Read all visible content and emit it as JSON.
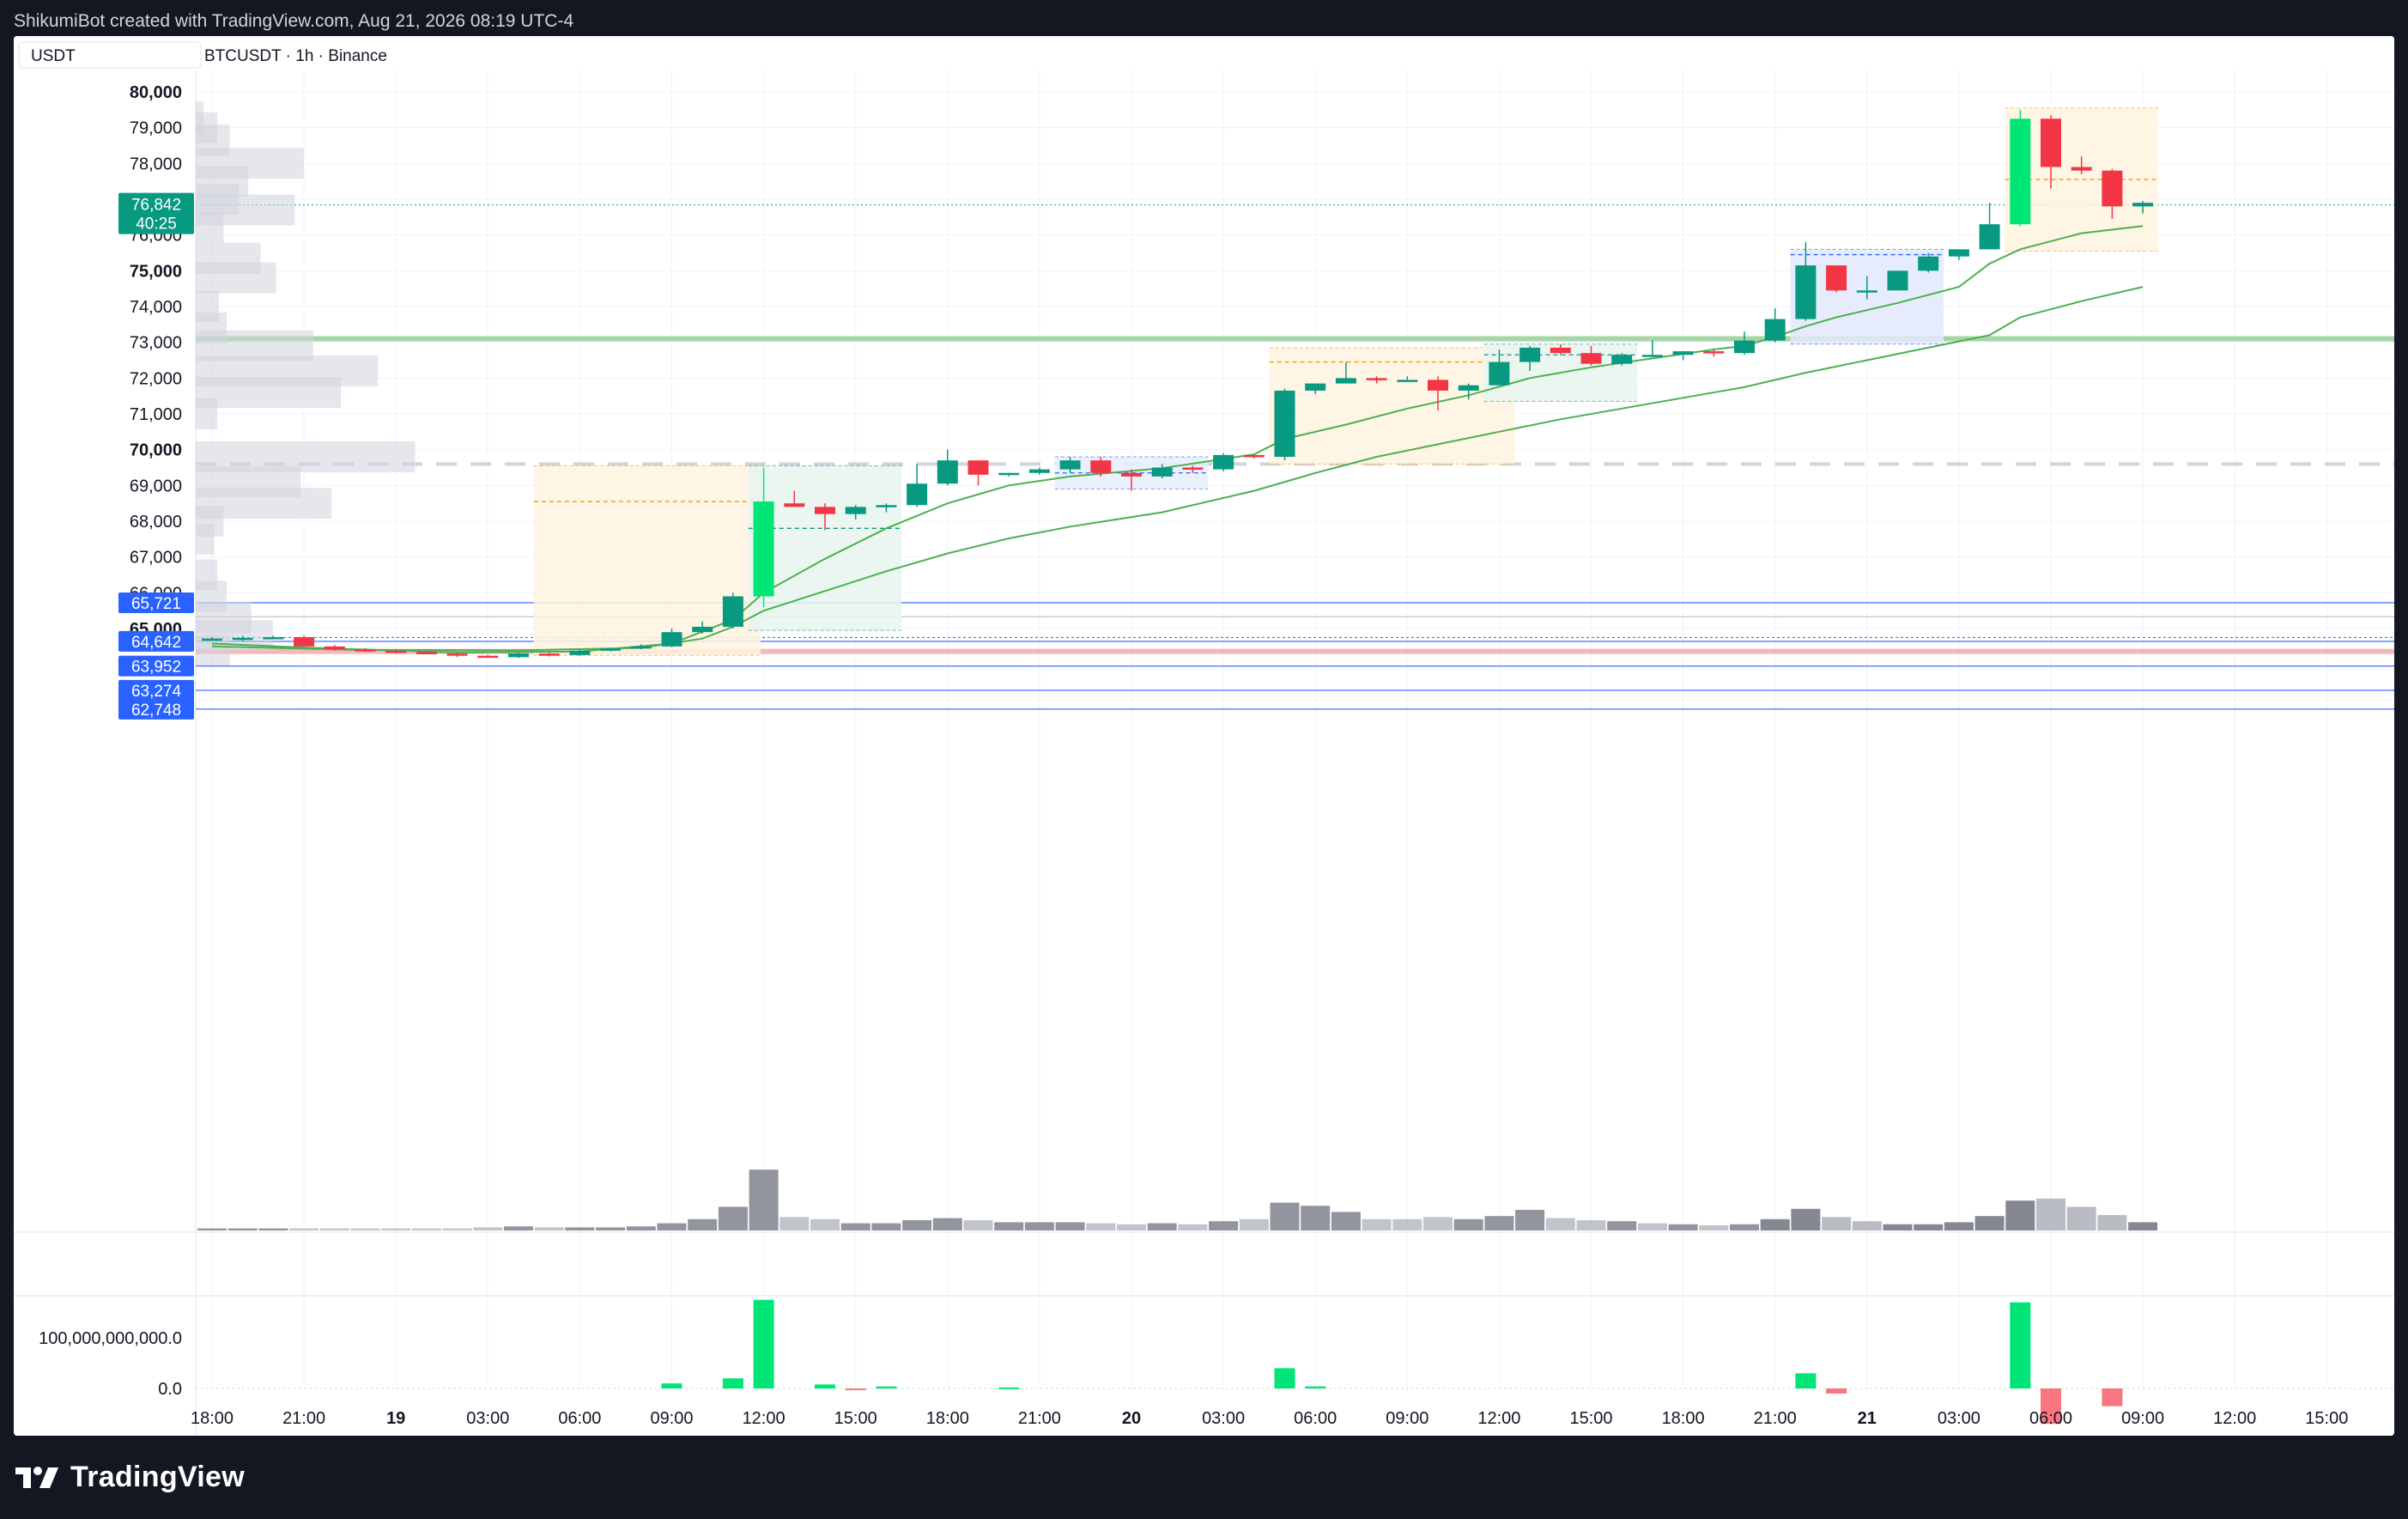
{
  "watermark": "ShikumiBot created with TradingView.com, Aug 21, 2026 08:19 UTC-4",
  "header": {
    "currency": "USDT",
    "symbol_line": "BTCUSDT · 1h · Binance"
  },
  "brand": {
    "name": "TradingView"
  },
  "colors": {
    "up": "#089981",
    "down": "#f23645",
    "up_bright": "#00e676",
    "ma": "#4caf50",
    "level_line": "#2962ff",
    "support_band": "#a5d6a7",
    "resistance_band": "#ef9a9a"
  },
  "chart_data": {
    "type": "candlestick",
    "symbol": "BTCUSDT",
    "interval": "1h",
    "exchange": "Binance",
    "ylim": [
      62600,
      80600
    ],
    "y_ticks": [
      {
        "value": 80000,
        "label": "80,000",
        "bold": true
      },
      {
        "value": 79000,
        "label": "79,000",
        "bold": false
      },
      {
        "value": 78000,
        "label": "78,000",
        "bold": false
      },
      {
        "value": 77000,
        "label": "77,000",
        "bold": false
      },
      {
        "value": 76000,
        "label": "76,000",
        "bold": false
      },
      {
        "value": 75000,
        "label": "75,000",
        "bold": true
      },
      {
        "value": 74000,
        "label": "74,000",
        "bold": false
      },
      {
        "value": 73000,
        "label": "73,000",
        "bold": false
      },
      {
        "value": 72000,
        "label": "72,000",
        "bold": false
      },
      {
        "value": 71000,
        "label": "71,000",
        "bold": false
      },
      {
        "value": 70000,
        "label": "70,000",
        "bold": true
      },
      {
        "value": 69000,
        "label": "69,000",
        "bold": false
      },
      {
        "value": 68000,
        "label": "68,000",
        "bold": false
      },
      {
        "value": 67000,
        "label": "67,000",
        "bold": false
      },
      {
        "value": 66000,
        "label": "66,000",
        "bold": false
      },
      {
        "value": 65000,
        "label": "65,000",
        "bold": true
      },
      {
        "value": 63000,
        "label": "63,000",
        "bold": false
      }
    ],
    "x_ticks": [
      {
        "label": "18:00",
        "bold": false
      },
      {
        "label": "21:00",
        "bold": false
      },
      {
        "label": "19",
        "bold": true
      },
      {
        "label": "03:00",
        "bold": false
      },
      {
        "label": "06:00",
        "bold": false
      },
      {
        "label": "09:00",
        "bold": false
      },
      {
        "label": "12:00",
        "bold": false
      },
      {
        "label": "15:00",
        "bold": false
      },
      {
        "label": "18:00",
        "bold": false
      },
      {
        "label": "21:00",
        "bold": false
      },
      {
        "label": "20",
        "bold": true
      },
      {
        "label": "03:00",
        "bold": false
      },
      {
        "label": "06:00",
        "bold": false
      },
      {
        "label": "09:00",
        "bold": false
      },
      {
        "label": "12:00",
        "bold": false
      },
      {
        "label": "15:00",
        "bold": false
      },
      {
        "label": "18:00",
        "bold": false
      },
      {
        "label": "21:00",
        "bold": false
      },
      {
        "label": "21",
        "bold": true
      },
      {
        "label": "03:00",
        "bold": false
      },
      {
        "label": "06:00",
        "bold": false
      },
      {
        "label": "09:00",
        "bold": false
      },
      {
        "label": "12:00",
        "bold": false
      },
      {
        "label": "15:00",
        "bold": false
      }
    ],
    "x_tick_step_bars": 3,
    "total_slots": 72,
    "candles": [
      [
        64700,
        64760,
        64660,
        64720
      ],
      [
        64720,
        64800,
        64650,
        64740
      ],
      [
        64740,
        64800,
        64700,
        64760
      ],
      [
        64760,
        64800,
        64480,
        64500
      ],
      [
        64500,
        64540,
        64380,
        64420
      ],
      [
        64420,
        64460,
        64340,
        64380
      ],
      [
        64380,
        64420,
        64300,
        64340
      ],
      [
        64340,
        64380,
        64280,
        64300
      ],
      [
        64300,
        64340,
        64200,
        64240
      ],
      [
        64240,
        64260,
        64180,
        64200
      ],
      [
        64200,
        64320,
        64180,
        64300
      ],
      [
        64300,
        64340,
        64220,
        64260
      ],
      [
        64260,
        64400,
        64240,
        64380
      ],
      [
        64380,
        64460,
        64360,
        64440
      ],
      [
        64440,
        64560,
        64420,
        64500
      ],
      [
        64500,
        65000,
        64480,
        64900
      ],
      [
        64900,
        65200,
        64860,
        65050
      ],
      [
        65050,
        66000,
        65000,
        65900
      ],
      [
        65900,
        69500,
        65600,
        68550
      ],
      [
        68500,
        68850,
        68400,
        68400
      ],
      [
        68400,
        68500,
        67750,
        68200
      ],
      [
        68200,
        68450,
        68050,
        68400
      ],
      [
        68400,
        68500,
        68250,
        68450
      ],
      [
        68450,
        69600,
        68400,
        69050
      ],
      [
        69050,
        70000,
        69000,
        69700
      ],
      [
        69700,
        69700,
        69000,
        69300
      ],
      [
        69300,
        69350,
        69250,
        69350
      ],
      [
        69350,
        69500,
        69300,
        69450
      ],
      [
        69450,
        69800,
        69350,
        69700
      ],
      [
        69700,
        69800,
        69250,
        69350
      ],
      [
        69350,
        69450,
        68850,
        69250
      ],
      [
        69250,
        69600,
        69200,
        69500
      ],
      [
        69500,
        69550,
        69350,
        69450
      ],
      [
        69450,
        69900,
        69400,
        69850
      ],
      [
        69850,
        69850,
        69750,
        69800
      ],
      [
        69800,
        71700,
        69700,
        71650
      ],
      [
        71650,
        71850,
        71550,
        71850
      ],
      [
        71850,
        72450,
        71850,
        72000
      ],
      [
        72000,
        72050,
        71850,
        71950
      ],
      [
        71950,
        72050,
        71950,
        71950
      ],
      [
        71950,
        72050,
        71100,
        71650
      ],
      [
        71650,
        71850,
        71400,
        71800
      ],
      [
        71800,
        72800,
        71800,
        72450
      ],
      [
        72450,
        72900,
        72200,
        72850
      ],
      [
        72850,
        72950,
        72650,
        72700
      ],
      [
        72700,
        72900,
        72350,
        72400
      ],
      [
        72400,
        72700,
        72350,
        72650
      ],
      [
        72650,
        73050,
        72600,
        72650
      ],
      [
        72650,
        72750,
        72500,
        72750
      ],
      [
        72750,
        72800,
        72600,
        72700
      ],
      [
        72700,
        73300,
        72650,
        73050
      ],
      [
        73050,
        73950,
        73000,
        73650
      ],
      [
        73650,
        75800,
        73600,
        75150
      ],
      [
        75150,
        75150,
        74400,
        74450
      ],
      [
        74450,
        74850,
        74200,
        74450
      ],
      [
        74450,
        75000,
        74450,
        75000
      ],
      [
        75000,
        75500,
        74950,
        75400
      ],
      [
        75400,
        75600,
        75300,
        75600
      ],
      [
        75600,
        76900,
        75600,
        76300
      ],
      [
        76300,
        79500,
        76250,
        79250
      ],
      [
        79250,
        79350,
        77300,
        77900
      ],
      [
        77900,
        78200,
        77700,
        77800
      ],
      [
        77800,
        77850,
        76450,
        76800
      ],
      [
        76800,
        76950,
        76600,
        76900
      ]
    ],
    "ema_fast": [
      [
        0,
        64580
      ],
      [
        3,
        64470
      ],
      [
        8,
        64330
      ],
      [
        12,
        64360
      ],
      [
        15,
        64580
      ],
      [
        17,
        65250
      ],
      [
        18,
        66000
      ],
      [
        20,
        66950
      ],
      [
        22,
        67800
      ],
      [
        24,
        68500
      ],
      [
        26,
        69000
      ],
      [
        28,
        69250
      ],
      [
        31,
        69480
      ],
      [
        34,
        69870
      ],
      [
        35,
        70300
      ],
      [
        37,
        70700
      ],
      [
        39,
        71150
      ],
      [
        41,
        71520
      ],
      [
        43,
        72000
      ],
      [
        45,
        72300
      ],
      [
        47,
        72550
      ],
      [
        49,
        72800
      ],
      [
        50,
        72900
      ],
      [
        51,
        73150
      ],
      [
        52,
        73450
      ],
      [
        53,
        73700
      ],
      [
        55,
        74100
      ],
      [
        57,
        74550
      ],
      [
        58,
        75200
      ],
      [
        59,
        75600
      ],
      [
        61,
        76050
      ],
      [
        63,
        76250
      ]
    ],
    "ema_slow": [
      [
        0,
        64500
      ],
      [
        5,
        64400
      ],
      [
        10,
        64390
      ],
      [
        14,
        64460
      ],
      [
        16,
        64720
      ],
      [
        17,
        65050
      ],
      [
        18,
        65500
      ],
      [
        20,
        66050
      ],
      [
        22,
        66600
      ],
      [
        24,
        67100
      ],
      [
        26,
        67520
      ],
      [
        28,
        67850
      ],
      [
        31,
        68250
      ],
      [
        34,
        68850
      ],
      [
        36,
        69350
      ],
      [
        38,
        69800
      ],
      [
        40,
        70150
      ],
      [
        42,
        70500
      ],
      [
        44,
        70850
      ],
      [
        46,
        71150
      ],
      [
        48,
        71450
      ],
      [
        50,
        71750
      ],
      [
        52,
        72150
      ],
      [
        54,
        72500
      ],
      [
        56,
        72850
      ],
      [
        58,
        73200
      ],
      [
        59,
        73700
      ],
      [
        61,
        74150
      ],
      [
        63,
        74550
      ]
    ],
    "current_price": {
      "value": 76842,
      "label": "76,842",
      "countdown": "40:25"
    },
    "price_tags": [
      {
        "value": 65721,
        "label": "65,721"
      },
      {
        "value": 64642,
        "label": "64,642"
      },
      {
        "value": 63952,
        "label": "63,952"
      },
      {
        "value": 63274,
        "label": "63,274"
      },
      {
        "value": 62748,
        "label": "62,748"
      }
    ],
    "gray_dashed_level": 69600,
    "green_level": 73100,
    "red_level": 64360,
    "range_boxes": [
      {
        "x0": 10.5,
        "x1": 17.9,
        "top": 69550,
        "bottom": 64250,
        "fill": "#fff3e0",
        "mid": 68550,
        "mid_to": 18.2,
        "mid_color": "#ff9800"
      },
      {
        "x0": 17.5,
        "x1": 22.5,
        "top": 69550,
        "bottom": 64950,
        "fill": "#e8f5ee",
        "mid": 67800,
        "mid_color": "#089981"
      },
      {
        "x0": 27.5,
        "x1": 32.5,
        "top": 69800,
        "bottom": 68900,
        "fill": "#e8eefb",
        "mid": 69350,
        "mid_color": "#2962ff"
      },
      {
        "x0": 34.5,
        "x1": 42.5,
        "top": 72850,
        "bottom": 69600,
        "fill": "#fff3e0",
        "mid": 72450,
        "mid_color": "#ff9800"
      },
      {
        "x0": 41.5,
        "x1": 46.5,
        "top": 72950,
        "bottom": 71350,
        "fill": "#e8f5ee",
        "mid": 72650,
        "mid_color": "#089981"
      },
      {
        "x0": 51.5,
        "x1": 56.5,
        "top": 75600,
        "bottom": 72950,
        "fill": "#e3e9fd",
        "mid": 75450,
        "mid_color": "#2962ff"
      },
      {
        "x0": 58.5,
        "x1": 63.5,
        "top": 79550,
        "bottom": 75550,
        "fill": "#fff3e0",
        "mid": 77550,
        "mid_color": "#ff9800"
      }
    ],
    "volume_profile": [
      [
        79300,
        5
      ],
      [
        79000,
        14
      ],
      [
        78650,
        22
      ],
      [
        78000,
        70
      ],
      [
        77500,
        34
      ],
      [
        77000,
        28
      ],
      [
        76700,
        64
      ],
      [
        76200,
        18
      ],
      [
        75350,
        42
      ],
      [
        74800,
        52
      ],
      [
        74000,
        15
      ],
      [
        73400,
        20
      ],
      [
        72900,
        76
      ],
      [
        72200,
        118
      ],
      [
        71600,
        94
      ],
      [
        71000,
        14
      ],
      [
        69800,
        142
      ],
      [
        69100,
        68
      ],
      [
        68500,
        88
      ],
      [
        68000,
        18
      ],
      [
        67500,
        12
      ],
      [
        66500,
        14
      ],
      [
        65900,
        20
      ],
      [
        65300,
        36
      ],
      [
        64800,
        50
      ],
      [
        64400,
        22
      ]
    ],
    "volume": [
      2,
      2,
      2,
      2,
      2,
      2,
      2,
      2,
      2,
      3,
      4,
      3,
      3,
      3,
      4,
      7,
      11,
      23,
      59,
      13,
      11,
      7,
      7,
      10,
      12,
      10,
      8,
      8,
      8,
      7,
      6,
      7,
      6,
      9,
      11,
      27,
      24,
      18,
      11,
      11,
      13,
      11,
      14,
      20,
      12,
      10,
      9,
      7,
      6,
      5,
      6,
      11,
      21,
      13,
      9,
      6,
      6,
      8,
      14,
      29,
      31,
      23,
      15,
      8
    ],
    "volume_up_flags": [
      1,
      1,
      1,
      0,
      0,
      0,
      0,
      0,
      0,
      0,
      1,
      0,
      1,
      1,
      1,
      1,
      1,
      1,
      1,
      0,
      0,
      1,
      1,
      1,
      1,
      0,
      1,
      1,
      1,
      0,
      0,
      1,
      0,
      1,
      0,
      1,
      1,
      1,
      0,
      0,
      0,
      1,
      1,
      1,
      0,
      0,
      1,
      0,
      1,
      0,
      1,
      1,
      1,
      0,
      0,
      1,
      1,
      1,
      1,
      1,
      0,
      0,
      0,
      1
    ],
    "oscillator": {
      "y_labels": [
        {
          "value": 100000000000.0,
          "label": "100,000,000,000.0"
        },
        {
          "value": 0,
          "label": "0.0"
        }
      ],
      "bars": [
        [
          15,
          10000000000
        ],
        [
          17,
          20000000000
        ],
        [
          18,
          175000000000
        ],
        [
          20,
          8000000000
        ],
        [
          21,
          -3000000000
        ],
        [
          22,
          4000000000
        ],
        [
          26,
          2000000000
        ],
        [
          35,
          40000000000
        ],
        [
          36,
          4000000000
        ],
        [
          52,
          30000000000
        ],
        [
          53,
          -10000000000
        ],
        [
          59,
          170000000000
        ],
        [
          60,
          -70000000000
        ],
        [
          62,
          -35000000000
        ]
      ]
    }
  }
}
